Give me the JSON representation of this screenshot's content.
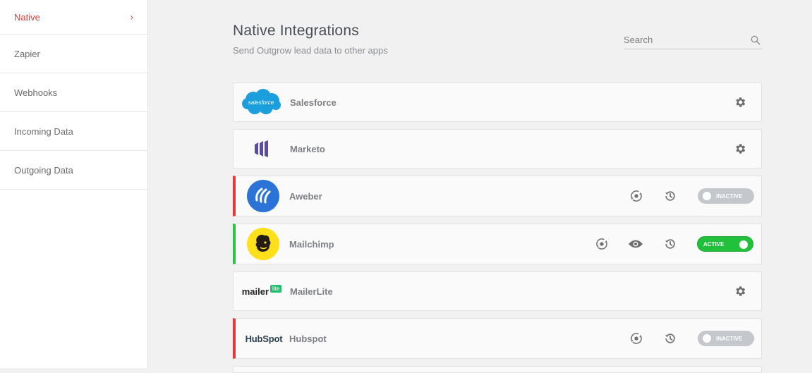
{
  "sidebar": {
    "items": [
      {
        "label": "Native",
        "active": true
      },
      {
        "label": "Zapier"
      },
      {
        "label": "Webhooks"
      },
      {
        "label": "Incoming Data"
      },
      {
        "label": "Outgoing Data"
      }
    ]
  },
  "header": {
    "title": "Native Integrations",
    "subtitle": "Send Outgrow lead data to other apps"
  },
  "search": {
    "placeholder": "Search"
  },
  "integrations": [
    {
      "name": "Salesforce",
      "logo_text": "salesforce",
      "status_bar": "none"
    },
    {
      "name": "Marketo",
      "status_bar": "none"
    },
    {
      "name": "Aweber",
      "status_bar": "red",
      "toggle": "INACTIVE"
    },
    {
      "name": "Mailchimp",
      "status_bar": "green",
      "toggle": "ACTIVE"
    },
    {
      "name": "MailerLite",
      "logo_text": "mailer",
      "logo_badge": "lite",
      "status_bar": "none"
    },
    {
      "name": "Hubspot",
      "logo_text": "HubSpot",
      "status_bar": "red",
      "toggle": "INACTIVE"
    }
  ],
  "colors": {
    "accent_red": "#e23b3b",
    "active_green": "#22c13b",
    "inactive_gray": "#c4c7cb",
    "salesforce_blue": "#1b9fdc",
    "marketo_purple": "#5c4c9f",
    "aweber_blue": "#2b73d6",
    "mailchimp_yellow": "#ffe01b",
    "mailerlite_green": "#21c16b",
    "hubspot_orange": "#f57722"
  }
}
